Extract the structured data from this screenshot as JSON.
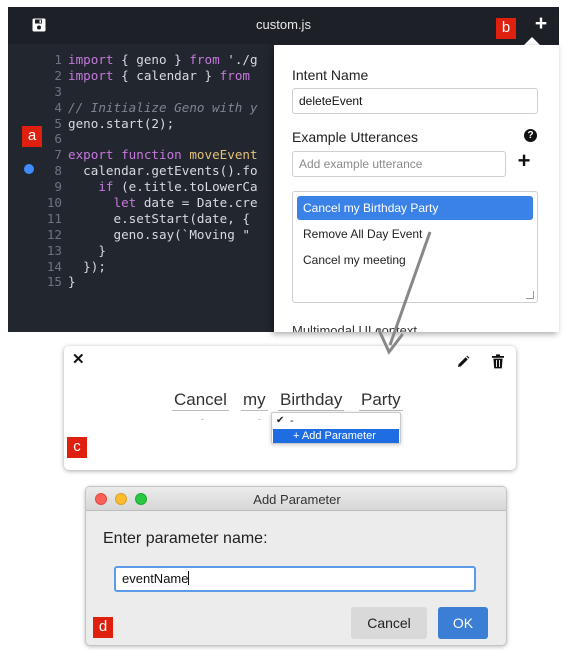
{
  "editor": {
    "title": "custom.js",
    "add_icon": "plus-icon",
    "save_icon": "save-icon",
    "lines": [
      {
        "num": "1",
        "tokens": [
          {
            "t": "import",
            "c": "kw"
          },
          {
            "t": " { geno } ",
            "c": "plain"
          },
          {
            "t": "from",
            "c": "kw"
          },
          {
            "t": " './g",
            "c": "plain"
          }
        ]
      },
      {
        "num": "2",
        "tokens": [
          {
            "t": "import",
            "c": "kw"
          },
          {
            "t": " { calendar } ",
            "c": "plain"
          },
          {
            "t": "from",
            "c": "kw"
          }
        ]
      },
      {
        "num": "3",
        "tokens": []
      },
      {
        "num": "4",
        "tokens": [
          {
            "t": "// Initialize Geno with y",
            "c": "cm"
          }
        ]
      },
      {
        "num": "5",
        "tokens": [
          {
            "t": "geno.start(2);",
            "c": "plain"
          }
        ]
      },
      {
        "num": "6",
        "tokens": []
      },
      {
        "num": "7",
        "tokens": [
          {
            "t": "export function ",
            "c": "kw"
          },
          {
            "t": "moveEvent",
            "c": "fn"
          }
        ]
      },
      {
        "num": "8",
        "tokens": [
          {
            "t": "  calendar.getEvents().fo",
            "c": "plain"
          }
        ]
      },
      {
        "num": "9",
        "tokens": [
          {
            "t": "    if",
            "c": "kw"
          },
          {
            "t": " (e.title.toLowerCa",
            "c": "plain"
          }
        ]
      },
      {
        "num": "10",
        "tokens": [
          {
            "t": "      let",
            "c": "kw"
          },
          {
            "t": " date = Date.cre",
            "c": "plain"
          }
        ]
      },
      {
        "num": "11",
        "tokens": [
          {
            "t": "      e.setStart(date, {",
            "c": "plain"
          }
        ]
      },
      {
        "num": "12",
        "tokens": [
          {
            "t": "      geno.say(`Moving \"",
            "c": "plain"
          }
        ]
      },
      {
        "num": "13",
        "tokens": [
          {
            "t": "    }",
            "c": "plain"
          }
        ]
      },
      {
        "num": "14",
        "tokens": [
          {
            "t": "  });",
            "c": "plain"
          }
        ]
      },
      {
        "num": "15",
        "tokens": [
          {
            "t": "}",
            "c": "plain"
          }
        ]
      }
    ]
  },
  "intent_panel": {
    "intent_name_label": "Intent Name",
    "intent_name_value": "deleteEvent",
    "utterances_label": "Example Utterances",
    "utterance_placeholder": "Add example utterance",
    "utterances": [
      "Cancel my Birthday Party",
      "Remove All Day Event",
      "Cancel my meeting"
    ],
    "selected_utterance_index": 0,
    "cut_label": "Multimodal UI context"
  },
  "utterance_panel": {
    "words": [
      {
        "text": "Cancel",
        "tag": "-"
      },
      {
        "text": "my",
        "tag": "-"
      },
      {
        "text": "Birthday",
        "tag": "-"
      },
      {
        "text": "Party",
        "tag": "-"
      }
    ],
    "param_menu": {
      "current": "-",
      "add_label": "+ Add Parameter"
    }
  },
  "dialog": {
    "title": "Add Parameter",
    "prompt": "Enter parameter name:",
    "input_value": "eventName",
    "cancel_label": "Cancel",
    "ok_label": "OK"
  },
  "markers": {
    "a": "a",
    "b": "b",
    "c": "c",
    "d": "d"
  },
  "colors": {
    "editor_bg": "#22262e",
    "selection_blue": "#3a82e8",
    "marker_red": "#e0200f",
    "ok_blue": "#3b7ed6",
    "breakpoint": "#3f8cff"
  }
}
